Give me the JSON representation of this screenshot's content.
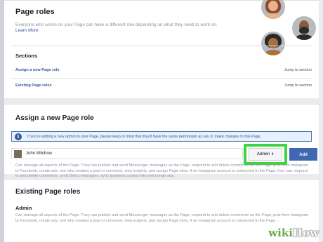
{
  "header": {
    "title": "Page roles",
    "description": "Everyone who works on your Page can have a different role depending on what they need to work on.",
    "learn_more": "Learn More"
  },
  "sections": {
    "title": "Sections",
    "items": [
      {
        "label": "Assign a new Page role",
        "jump": "Jump to section"
      },
      {
        "label": "Existing Page roles",
        "jump": "Jump to section"
      }
    ]
  },
  "assign": {
    "title": "Assign a new Page role",
    "notice": "If you're adding a new admin to your Page, please keep in mind that they'll have the same permission as you to make changes to this Page.",
    "user_name": "John Wikihow",
    "role_value": "Admin",
    "add_label": "Add",
    "role_description": "Can manage all aspects of the Page. They can publish and send Messenger messages as the Page, respond to and delete comments on the Page, post from Instagram to Facebook, create ads, see who created a post or comment, view insights, and assign Page roles. If an Instagram account is connected to the Page, they can respond to and delete comments, send Direct messages, sync business contact info and create ads."
  },
  "existing": {
    "title": "Existing Page roles",
    "role_title": "Admin",
    "role_description": "Can manage all aspects of the Page. They can publish and send Messenger messages as the Page, respond to and delete comments on the Page, post from Instagram to Facebook, create ads, see who created a post or comment, view insights, and assign Page roles. If an Instagram account is connected to the Page..."
  },
  "watermark": {
    "brand_a": "wiki",
    "brand_b": "How"
  },
  "colors": {
    "accent": "#4267b2",
    "link": "#365899",
    "highlight": "#3fd43f"
  }
}
